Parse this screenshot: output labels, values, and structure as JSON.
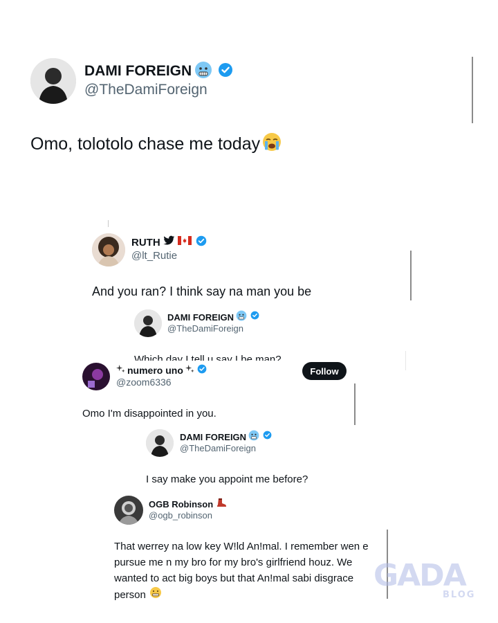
{
  "main_post": {
    "name": "DAMI FOREIGN",
    "handle": "@TheDamiForeign",
    "text": "Omo, tolotolo chase me today"
  },
  "reply_ruth": {
    "name": "RUTH",
    "handle": "@lt_Rutie",
    "text": "And you ran? I think say na man you be"
  },
  "reply_dami_1": {
    "name": "DAMI FOREIGN",
    "handle": "@TheDamiForeign",
    "text": "Which day I tell u say I be man?"
  },
  "reply_numero": {
    "name": "numero uno",
    "handle": "@zoom6336",
    "follow_label": "Follow",
    "text": "Omo I'm disappointed in you."
  },
  "reply_dami_2": {
    "name": "DAMI FOREIGN",
    "handle": "@TheDamiForeign",
    "text": "I say make you appoint me before?"
  },
  "reply_ogb": {
    "name": "OGB Robinson",
    "handle": "@ogb_robinson",
    "text_lines": [
      "That werrey na low key W!ld An!mal. I remember wen e",
      "pursue me n my bro for my bro's girlfriend houz. We",
      "wanted to act big boys but that An!mal sabi disgrace",
      "person"
    ]
  },
  "watermark": {
    "main": "GADA",
    "sub": "BLOG"
  },
  "colors": {
    "verified_blue": "#1d9bf0",
    "text_primary": "#0f1419",
    "text_secondary": "#536471"
  },
  "icons": {
    "verified": "verified-badge-icon",
    "cold_face": "cold-face-emoji",
    "crying_face": "loudly-crying-emoji",
    "twitter_bird": "twitter-bird-icon",
    "canada_flag": "canada-flag-emoji",
    "sparkles": "sparkles-emoji",
    "boot": "boot-emoji",
    "grimace": "grimacing-emoji"
  }
}
